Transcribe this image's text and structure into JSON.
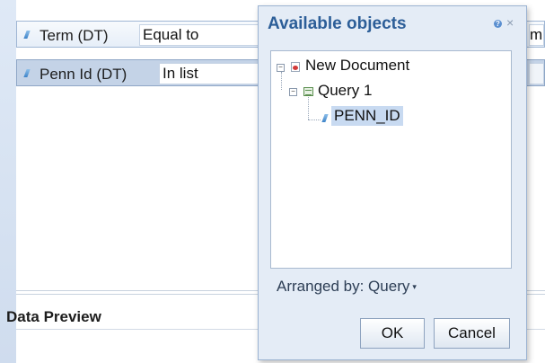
{
  "filters": [
    {
      "label": "Term (DT)",
      "operator": "Equal to",
      "value": "mi"
    },
    {
      "label": "Penn Id (DT)",
      "operator": "In list",
      "value": ""
    }
  ],
  "data_preview": {
    "title": "Data Preview"
  },
  "dialog": {
    "title": "Available objects",
    "tree": {
      "root": "New Document",
      "query": "Query 1",
      "object": "PENN_ID"
    },
    "arranged_by": "Arranged by: Query",
    "ok_label": "OK",
    "cancel_label": "Cancel",
    "close_glyph": "×",
    "help_glyph": "?"
  }
}
